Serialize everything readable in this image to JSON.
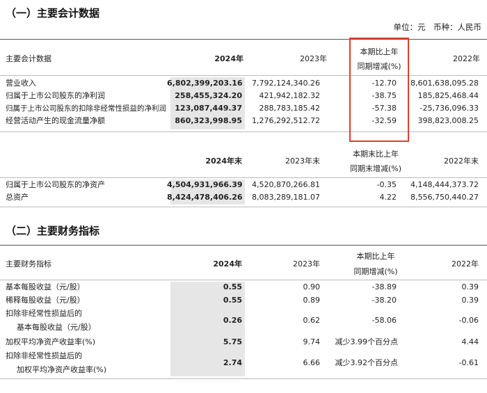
{
  "section1": {
    "title": "（一）主要会计数据",
    "unit_note": "单位：元　币种：人民币",
    "table1": {
      "headers": [
        "主要会计数据",
        "2024年",
        "2023年",
        "本期比上年",
        "同期增减(%)",
        "2022年"
      ],
      "rows": [
        {
          "label": "营业收入",
          "y2024": "6,802,399,203.16",
          "y2023": "7,792,124,340.26",
          "change": "-12.70",
          "y2022": "8,601,638,095.28"
        },
        {
          "label": "归属于上市公司股东的净利润",
          "y2024": "258,455,324.20",
          "y2023": "421,942,182.32",
          "change": "-38.75",
          "y2022": "185,825,468.44"
        },
        {
          "label": "归属于上市公司股东的扣除非经常性损益的净利润",
          "y2024": "123,087,449.37",
          "y2023": "288,783,185.42",
          "change": "-57.38",
          "y2022": "-25,736,096.33"
        },
        {
          "label": "经营活动产生的现金流量净额",
          "y2024": "860,323,998.95",
          "y2023": "1,276,292,512.72",
          "change": "-32.59",
          "y2022": "398,823,008.25"
        }
      ]
    },
    "table2": {
      "headers": [
        "2024年末",
        "2023年末",
        "本期末比上年",
        "同期末增减(%)",
        "2022年末"
      ],
      "rows": [
        {
          "label": "归属于上市公司股东的净资产",
          "y2024": "4,504,931,966.39",
          "y2023": "4,520,870,266.81",
          "change": "-0.35",
          "y2022": "4,148,444,373.72"
        },
        {
          "label": "总资产",
          "y2024": "8,424,478,406.26",
          "y2023": "8,083,289,181.07",
          "change": "4.22",
          "y2022": "8,556,750,440.27"
        }
      ]
    }
  },
  "section2": {
    "title": "（二）主要财务指标",
    "table": {
      "headers": [
        "主要财务指标",
        "2024年",
        "2023年",
        "本期比上年",
        "同期增减(%)",
        "2022年"
      ],
      "rows": [
        {
          "label": "基本每股收益（元/股）",
          "y2024": "0.55",
          "y2023": "0.90",
          "change": "-38.89",
          "y2022": "0.39"
        },
        {
          "label": "稀释每股收益（元/股）",
          "y2024": "0.55",
          "y2023": "0.89",
          "change": "-38.20",
          "y2022": "0.39"
        },
        {
          "label": "扣除非经常性损益后的",
          "label2": "基本每股收益（元/股）",
          "y2024": "0.26",
          "y2023": "0.62",
          "change": "-58.06",
          "y2022": "-0.06"
        },
        {
          "label": "加权平均净资产收益率(%)",
          "y2024": "5.75",
          "y2023": "9.74",
          "change": "减少3.99个百分点",
          "y2022": "4.44"
        },
        {
          "label": "扣除非经常性损益后的",
          "label2": "加权平均净资产收益率(%)",
          "y2024": "2.74",
          "y2023": "6.66",
          "change": "减少3.92个百分点",
          "y2022": "-0.61"
        }
      ]
    }
  },
  "colors": {
    "highlight_box": "#e23b32",
    "shaded_column": "#e6e6e6"
  }
}
